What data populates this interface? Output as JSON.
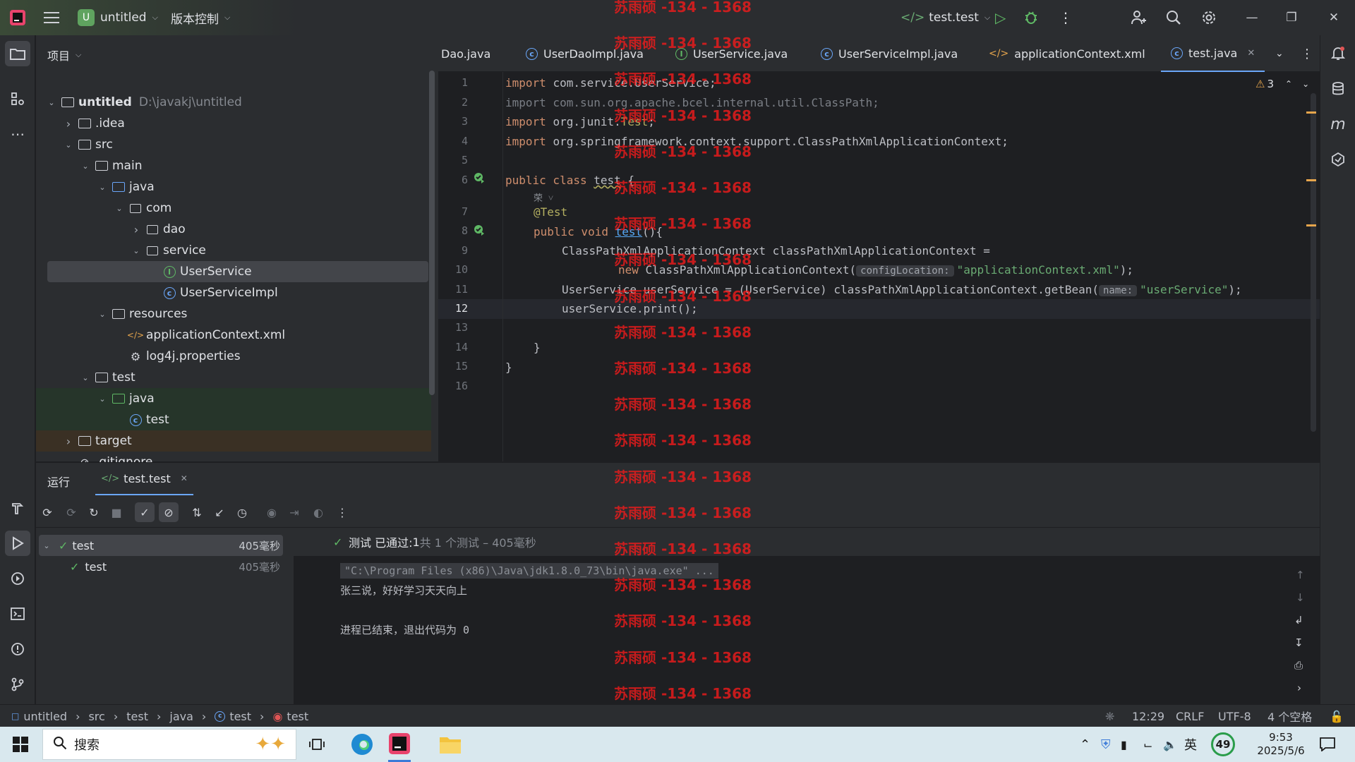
{
  "titlebar": {
    "project_badge": "U",
    "project_name": "untitled",
    "vcs_label": "版本控制",
    "run_config": "test.test"
  },
  "project_panel": {
    "title": "项目",
    "tree": [
      {
        "label": "untitled",
        "path": "D:\\javakj\\untitled",
        "depth": 0,
        "arrow": "expanded",
        "icon": "folder-icon"
      },
      {
        "label": ".idea",
        "depth": 1,
        "arrow": "collapsed",
        "icon": "folder-icon"
      },
      {
        "label": "src",
        "depth": 1,
        "arrow": "expanded",
        "icon": "folder-icon"
      },
      {
        "label": "main",
        "depth": 2,
        "arrow": "expanded",
        "icon": "folder-icon"
      },
      {
        "label": "java",
        "depth": 3,
        "arrow": "expanded",
        "icon": "source-folder-icon"
      },
      {
        "label": "com",
        "depth": 4,
        "arrow": "expanded",
        "icon": "package-icon"
      },
      {
        "label": "dao",
        "depth": 5,
        "arrow": "collapsed",
        "icon": "package-icon"
      },
      {
        "label": "service",
        "depth": 5,
        "arrow": "expanded",
        "icon": "package-icon"
      },
      {
        "label": "UserService",
        "depth": 6,
        "arrow": "none",
        "icon": "interface-icon",
        "selected": true
      },
      {
        "label": "UserServiceImpl",
        "depth": 6,
        "arrow": "none",
        "icon": "class-icon"
      },
      {
        "label": "resources",
        "depth": 3,
        "arrow": "expanded",
        "icon": "resources-folder-icon"
      },
      {
        "label": "applicationContext.xml",
        "depth": 4,
        "arrow": "none",
        "icon": "xml-icon"
      },
      {
        "label": "log4j.properties",
        "depth": 4,
        "arrow": "none",
        "icon": "properties-icon"
      },
      {
        "label": "test",
        "depth": 2,
        "arrow": "expanded",
        "icon": "folder-icon"
      },
      {
        "label": "java",
        "depth": 3,
        "arrow": "expanded",
        "icon": "test-folder-icon",
        "highlight": "green"
      },
      {
        "label": "test",
        "depth": 4,
        "arrow": "none",
        "icon": "class-icon",
        "highlight": "green"
      },
      {
        "label": "target",
        "depth": 1,
        "arrow": "collapsed",
        "icon": "folder-icon",
        "highlight": "orange"
      },
      {
        "label": ".gitignore",
        "depth": 1,
        "arrow": "none",
        "icon": "ignore-icon"
      }
    ]
  },
  "editor": {
    "tabs": [
      {
        "label": "Dao.java",
        "icon": "none"
      },
      {
        "label": "UserDaoImpl.java",
        "icon": "class-icon"
      },
      {
        "label": "UserService.java",
        "icon": "interface-icon"
      },
      {
        "label": "UserServiceImpl.java",
        "icon": "class-icon"
      },
      {
        "label": "applicationContext.xml",
        "icon": "xml-icon"
      },
      {
        "label": "test.java",
        "icon": "class-icon",
        "active": true
      }
    ],
    "warnings_count": "3",
    "line_numbers": [
      "1",
      "2",
      "3",
      "4",
      "5",
      "6",
      "7",
      "8",
      "9",
      "10",
      "11",
      "12",
      "13",
      "14",
      "15",
      "16"
    ],
    "code": {
      "l1a": "import ",
      "l1b": "com.service.UserService;",
      "l2": "import com.sun.org.apache.bcel.internal.util.ClassPath;",
      "l3a": "import ",
      "l3b": "org.junit.",
      "l3c": "Test",
      "l3d": ";",
      "l4a": "import ",
      "l4b": "org.springframework.context.support.ClassPathXmlApplicationContext;",
      "l6a": "public class ",
      "l6b": "test",
      "l6c": " {",
      "l7": "@Test",
      "l8a": "public void ",
      "l8b": "test",
      "l8c": "(){",
      "l9": "ClassPathXmlApplicationContext classPathXmlApplicationContext =",
      "l10a": "new ",
      "l10b": "ClassPathXmlApplicationContext(",
      "l10hint": "configLocation:",
      "l10c": "\"applicationContext.xml\"",
      "l10d": ");",
      "l11a": "UserService userService = (UserService) classPathXmlApplicationContext.getBean(",
      "l11hint": "name:",
      "l11b": "\"userService\"",
      "l11c": ");",
      "l12": "userService.print();",
      "l14": "}",
      "l15": "}",
      "author_hint": "荣 ˅"
    },
    "watermark": "苏雨硕 -134 - 1368"
  },
  "run_panel": {
    "title": "运行",
    "tab": "test.test",
    "tests": [
      {
        "name": "test",
        "time": "405毫秒",
        "depth": 0
      },
      {
        "name": "test",
        "time": "405毫秒",
        "depth": 1
      }
    ],
    "summary_a": "测试 已通过: ",
    "summary_b": "1",
    "summary_c": "共 1 个测试 – 405毫秒",
    "console": [
      "\"C:\\Program Files (x86)\\Java\\jdk1.8.0_73\\bin\\java.exe\" ...",
      "张三说，好好学习天天向上",
      "",
      "进程已结束，退出代码为 0"
    ]
  },
  "status_bar": {
    "breadcrumb": [
      "untitled",
      "src",
      "test",
      "java",
      "test",
      "test"
    ],
    "position": "12:29",
    "line_sep": "CRLF",
    "encoding": "UTF-8",
    "indent": "4 个空格"
  },
  "taskbar": {
    "search_placeholder": "搜索",
    "ime": "英",
    "badge": "49",
    "time": "9:53",
    "date": "2025/5/6"
  },
  "colors": {
    "accent": "#6aa6f8",
    "success": "#5fb865",
    "watermark": "#ff1a1a"
  }
}
